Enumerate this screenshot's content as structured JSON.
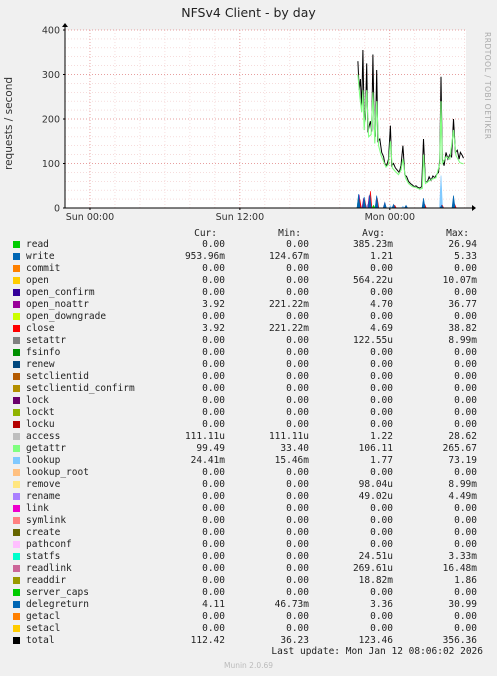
{
  "title": "NFSv4 Client - by day",
  "ylabel": "requests / second",
  "watermark": "RRDTOOL / TOBI OETIKER",
  "columns": {
    "cur": "Cur:",
    "min": "Min:",
    "avg": "Avg:",
    "max": "Max:"
  },
  "legend": [
    {
      "name": "read",
      "color": "#00cc00",
      "cur": "0.00",
      "min": "0.00",
      "avg": "385.23m",
      "max": "26.94"
    },
    {
      "name": "write",
      "color": "#0066b3",
      "cur": "953.96m",
      "min": "124.67m",
      "avg": "1.21",
      "max": "5.33"
    },
    {
      "name": "commit",
      "color": "#ff8000",
      "cur": "0.00",
      "min": "0.00",
      "avg": "0.00",
      "max": "0.00"
    },
    {
      "name": "open",
      "color": "#ffcc00",
      "cur": "0.00",
      "min": "0.00",
      "avg": "564.22u",
      "max": "10.07m"
    },
    {
      "name": "open_confirm",
      "color": "#330099",
      "cur": "0.00",
      "min": "0.00",
      "avg": "0.00",
      "max": "0.00"
    },
    {
      "name": "open_noattr",
      "color": "#990099",
      "cur": "3.92",
      "min": "221.22m",
      "avg": "4.70",
      "max": "36.77"
    },
    {
      "name": "open_downgrade",
      "color": "#ccff00",
      "cur": "0.00",
      "min": "0.00",
      "avg": "0.00",
      "max": "0.00"
    },
    {
      "name": "close",
      "color": "#ff0000",
      "cur": "3.92",
      "min": "221.22m",
      "avg": "4.69",
      "max": "38.82"
    },
    {
      "name": "setattr",
      "color": "#808080",
      "cur": "0.00",
      "min": "0.00",
      "avg": "122.55u",
      "max": "8.99m"
    },
    {
      "name": "fsinfo",
      "color": "#008f00",
      "cur": "0.00",
      "min": "0.00",
      "avg": "0.00",
      "max": "0.00"
    },
    {
      "name": "renew",
      "color": "#00487d",
      "cur": "0.00",
      "min": "0.00",
      "avg": "0.00",
      "max": "0.00"
    },
    {
      "name": "setclientid",
      "color": "#b35a00",
      "cur": "0.00",
      "min": "0.00",
      "avg": "0.00",
      "max": "0.00"
    },
    {
      "name": "setclientid_confirm",
      "color": "#b38f00",
      "cur": "0.00",
      "min": "0.00",
      "avg": "0.00",
      "max": "0.00"
    },
    {
      "name": "lock",
      "color": "#6b006b",
      "cur": "0.00",
      "min": "0.00",
      "avg": "0.00",
      "max": "0.00"
    },
    {
      "name": "lockt",
      "color": "#8fb300",
      "cur": "0.00",
      "min": "0.00",
      "avg": "0.00",
      "max": "0.00"
    },
    {
      "name": "locku",
      "color": "#b30000",
      "cur": "0.00",
      "min": "0.00",
      "avg": "0.00",
      "max": "0.00"
    },
    {
      "name": "access",
      "color": "#bebebe",
      "cur": "111.11u",
      "min": "111.11u",
      "avg": "1.22",
      "max": "28.62"
    },
    {
      "name": "getattr",
      "color": "#80ff80",
      "cur": "99.49",
      "min": "33.40",
      "avg": "106.11",
      "max": "265.67"
    },
    {
      "name": "lookup",
      "color": "#80c9ff",
      "cur": "24.41m",
      "min": "15.46m",
      "avg": "1.77",
      "max": "73.19"
    },
    {
      "name": "lookup_root",
      "color": "#ffc080",
      "cur": "0.00",
      "min": "0.00",
      "avg": "0.00",
      "max": "0.00"
    },
    {
      "name": "remove",
      "color": "#ffe680",
      "cur": "0.00",
      "min": "0.00",
      "avg": "98.04u",
      "max": "8.99m"
    },
    {
      "name": "rename",
      "color": "#aa80ff",
      "cur": "0.00",
      "min": "0.00",
      "avg": "49.02u",
      "max": "4.49m"
    },
    {
      "name": "link",
      "color": "#ee00cc",
      "cur": "0.00",
      "min": "0.00",
      "avg": "0.00",
      "max": "0.00"
    },
    {
      "name": "symlink",
      "color": "#ff8080",
      "cur": "0.00",
      "min": "0.00",
      "avg": "0.00",
      "max": "0.00"
    },
    {
      "name": "create",
      "color": "#666600",
      "cur": "0.00",
      "min": "0.00",
      "avg": "0.00",
      "max": "0.00"
    },
    {
      "name": "pathconf",
      "color": "#ffbfff",
      "cur": "0.00",
      "min": "0.00",
      "avg": "0.00",
      "max": "0.00"
    },
    {
      "name": "statfs",
      "color": "#00ffcc",
      "cur": "0.00",
      "min": "0.00",
      "avg": "24.51u",
      "max": "3.33m"
    },
    {
      "name": "readlink",
      "color": "#cc6699",
      "cur": "0.00",
      "min": "0.00",
      "avg": "269.61u",
      "max": "16.48m"
    },
    {
      "name": "readdir",
      "color": "#999900",
      "cur": "0.00",
      "min": "0.00",
      "avg": "18.82m",
      "max": "1.86"
    },
    {
      "name": "server_caps",
      "color": "#00cc00",
      "cur": "0.00",
      "min": "0.00",
      "avg": "0.00",
      "max": "0.00"
    },
    {
      "name": "delegreturn",
      "color": "#0066b3",
      "cur": "4.11",
      "min": "46.73m",
      "avg": "3.36",
      "max": "30.99"
    },
    {
      "name": "getacl",
      "color": "#ff8000",
      "cur": "0.00",
      "min": "0.00",
      "avg": "0.00",
      "max": "0.00"
    },
    {
      "name": "setacl",
      "color": "#ffcc00",
      "cur": "0.00",
      "min": "0.00",
      "avg": "0.00",
      "max": "0.00"
    },
    {
      "name": "total",
      "color": "#000000",
      "cur": "112.42",
      "min": "36.23",
      "avg": "123.46",
      "max": "356.36"
    }
  ],
  "last_update": "Last update: Mon Jan 12 08:06:02 2026",
  "footer": "Munin 2.0.69",
  "chart_data": {
    "type": "line",
    "title": "NFSv4 Client - by day",
    "ylabel": "requests / second",
    "xlabel": "",
    "ylim": [
      0,
      400
    ],
    "yticks": [
      0,
      100,
      200,
      300,
      400
    ],
    "xlim_hours": [
      -2,
      30.1
    ],
    "xticks": [
      {
        "hour": 0,
        "label": "Sun 00:00"
      },
      {
        "hour": 12,
        "label": "Sun 12:00"
      },
      {
        "hour": 24,
        "label": "Mon 00:00"
      }
    ],
    "grid": true,
    "series": [
      {
        "name": "total",
        "color": "#000000",
        "style": "line",
        "points": [
          [
            21.45,
            330
          ],
          [
            21.55,
            265
          ],
          [
            21.65,
            290
          ],
          [
            21.75,
            225
          ],
          [
            21.85,
            355
          ],
          [
            21.95,
            190
          ],
          [
            22.05,
            200
          ],
          [
            22.15,
            325
          ],
          [
            22.25,
            170
          ],
          [
            22.35,
            185
          ],
          [
            22.45,
            195
          ],
          [
            22.55,
            172
          ],
          [
            22.65,
            345
          ],
          [
            22.75,
            180
          ],
          [
            22.85,
            160
          ],
          [
            22.95,
            310
          ],
          [
            23.05,
            150
          ],
          [
            23.2,
            155
          ],
          [
            23.35,
            125
          ],
          [
            23.5,
            115
          ],
          [
            23.6,
            100
          ],
          [
            23.75,
            95
          ],
          [
            23.9,
            110
          ],
          [
            24.05,
            185
          ],
          [
            24.15,
            95
          ],
          [
            24.3,
            100
          ],
          [
            24.45,
            90
          ],
          [
            24.6,
            85
          ],
          [
            24.75,
            80
          ],
          [
            24.9,
            95
          ],
          [
            25.05,
            140
          ],
          [
            25.2,
            75
          ],
          [
            25.35,
            70
          ],
          [
            25.5,
            60
          ],
          [
            25.65,
            55
          ],
          [
            25.8,
            52
          ],
          [
            25.95,
            48
          ],
          [
            26.1,
            50
          ],
          [
            26.25,
            46
          ],
          [
            26.4,
            45
          ],
          [
            26.55,
            48
          ],
          [
            26.7,
            155
          ],
          [
            26.85,
            60
          ],
          [
            27.0,
            58
          ],
          [
            27.15,
            70
          ],
          [
            27.3,
            62
          ],
          [
            27.45,
            72
          ],
          [
            27.6,
            68
          ],
          [
            27.75,
            75
          ],
          [
            27.9,
            80
          ],
          [
            28.0,
            110
          ],
          [
            28.1,
            295
          ],
          [
            28.2,
            110
          ],
          [
            28.35,
            95
          ],
          [
            28.5,
            125
          ],
          [
            28.65,
            110
          ],
          [
            28.8,
            120
          ],
          [
            28.95,
            115
          ],
          [
            29.1,
            200
          ],
          [
            29.25,
            125
          ],
          [
            29.4,
            130
          ],
          [
            29.55,
            110
          ],
          [
            29.65,
            125
          ],
          [
            29.8,
            118
          ],
          [
            29.9,
            112
          ]
        ]
      },
      {
        "name": "getattr",
        "color": "#80ff80",
        "style": "line",
        "points": [
          [
            21.45,
            300
          ],
          [
            21.6,
            250
          ],
          [
            21.75,
            215
          ],
          [
            21.85,
            265
          ],
          [
            21.95,
            175
          ],
          [
            22.15,
            265
          ],
          [
            22.3,
            160
          ],
          [
            22.5,
            165
          ],
          [
            22.65,
            260
          ],
          [
            22.8,
            145
          ],
          [
            22.95,
            240
          ],
          [
            23.1,
            140
          ],
          [
            23.3,
            118
          ],
          [
            23.5,
            105
          ],
          [
            23.7,
            92
          ],
          [
            23.9,
            98
          ],
          [
            24.05,
            150
          ],
          [
            24.2,
            90
          ],
          [
            24.45,
            82
          ],
          [
            24.7,
            75
          ],
          [
            24.9,
            85
          ],
          [
            25.05,
            110
          ],
          [
            25.25,
            68
          ],
          [
            25.5,
            55
          ],
          [
            25.8,
            48
          ],
          [
            26.1,
            46
          ],
          [
            26.4,
            42
          ],
          [
            26.6,
            44
          ],
          [
            26.7,
            120
          ],
          [
            26.85,
            55
          ],
          [
            27.1,
            60
          ],
          [
            27.4,
            65
          ],
          [
            27.7,
            68
          ],
          [
            28.0,
            100
          ],
          [
            28.1,
            240
          ],
          [
            28.2,
            100
          ],
          [
            28.5,
            115
          ],
          [
            28.8,
            110
          ],
          [
            29.1,
            175
          ],
          [
            29.3,
            118
          ],
          [
            29.6,
            102
          ],
          [
            29.9,
            99
          ]
        ]
      },
      {
        "name": "lookup",
        "color": "#80c9ff",
        "style": "spikes",
        "points": [
          [
            21.45,
            4
          ],
          [
            21.85,
            12
          ],
          [
            22.2,
            8
          ],
          [
            22.95,
            6
          ],
          [
            24.05,
            5
          ],
          [
            25.05,
            4
          ],
          [
            26.7,
            12
          ],
          [
            28.1,
            73
          ],
          [
            29.1,
            6
          ]
        ]
      },
      {
        "name": "read",
        "color": "#00cc00",
        "style": "spikes",
        "points": [
          [
            21.5,
            27
          ],
          [
            22.7,
            6
          ],
          [
            26.7,
            8
          ]
        ]
      },
      {
        "name": "open_noattr",
        "color": "#990099",
        "style": "spikes",
        "points": [
          [
            21.55,
            30
          ],
          [
            21.9,
            22
          ],
          [
            22.35,
            28
          ],
          [
            22.95,
            26
          ],
          [
            23.6,
            12
          ],
          [
            24.3,
            6
          ],
          [
            25.3,
            5
          ],
          [
            26.75,
            8
          ],
          [
            28.15,
            6
          ],
          [
            29.15,
            10
          ]
        ]
      },
      {
        "name": "close",
        "color": "#ff0000",
        "style": "spikes",
        "points": [
          [
            21.6,
            20
          ],
          [
            22.0,
            18
          ],
          [
            22.45,
            38
          ],
          [
            23.0,
            22
          ],
          [
            24.4,
            6
          ],
          [
            26.8,
            8
          ],
          [
            28.2,
            6
          ],
          [
            29.2,
            8
          ]
        ]
      },
      {
        "name": "delegreturn",
        "color": "#0066b3",
        "style": "spikes",
        "points": [
          [
            21.5,
            31
          ],
          [
            21.95,
            25
          ],
          [
            22.4,
            30
          ],
          [
            22.95,
            28
          ],
          [
            23.6,
            12
          ],
          [
            24.3,
            8
          ],
          [
            25.3,
            6
          ],
          [
            26.7,
            22
          ],
          [
            28.15,
            6
          ],
          [
            29.1,
            28
          ]
        ]
      },
      {
        "name": "write",
        "color": "#0066b3",
        "style": "spikes",
        "points": [
          [
            21.5,
            5
          ],
          [
            22.0,
            4
          ],
          [
            23.0,
            4
          ],
          [
            26.7,
            5
          ],
          [
            29.1,
            4
          ]
        ]
      }
    ]
  }
}
